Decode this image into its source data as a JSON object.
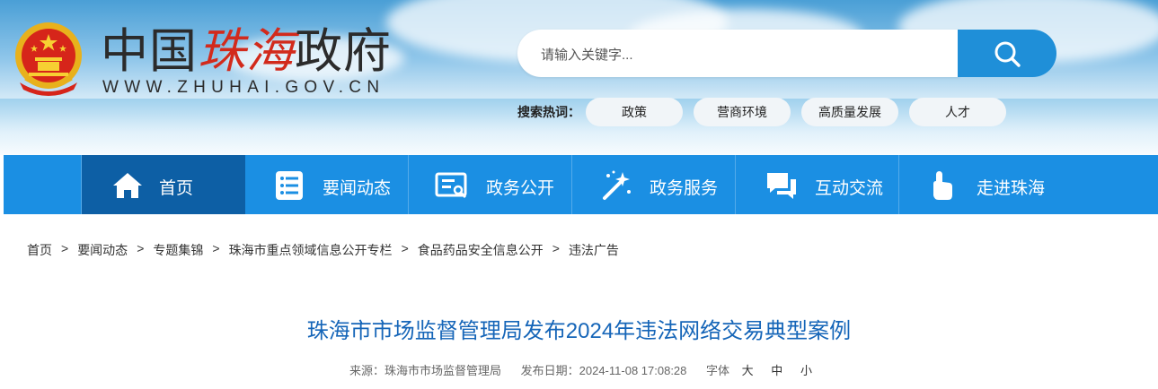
{
  "header": {
    "logo_main_a": "中国",
    "logo_main_b": "珠海",
    "logo_main_c": "政府",
    "logo_url": "WWW.ZHUHAI.GOV.CN",
    "search_placeholder": "请输入关键字...",
    "hot_label": "搜索热词：",
    "hot_tags": [
      "政策",
      "营商环境",
      "高质量发展",
      "人才"
    ]
  },
  "nav": {
    "items": [
      {
        "label": "首页",
        "icon": "home-icon",
        "active": true
      },
      {
        "label": "要闻动态",
        "icon": "news-list-icon"
      },
      {
        "label": "政务公开",
        "icon": "document-icon"
      },
      {
        "label": "政务服务",
        "icon": "magic-wand-icon"
      },
      {
        "label": "互动交流",
        "icon": "chat-icon"
      },
      {
        "label": "走进珠海",
        "icon": "pointer-hand-icon"
      }
    ]
  },
  "breadcrumb": [
    "首页",
    "要闻动态",
    "专题集锦",
    "珠海市重点领域信息公开专栏",
    "食品药品安全信息公开",
    "违法广告"
  ],
  "article": {
    "title": "珠海市市场监督管理局发布2024年违法网络交易典型案例",
    "source_label": "来源：珠海市市场监督管理局",
    "date_label": "发布日期：2024-11-08 17:08:28",
    "font_label": "字体",
    "font_sizes": [
      "大",
      "中",
      "小"
    ]
  },
  "colors": {
    "nav_bg": "#1b8fe3",
    "nav_active": "#0d5fa5",
    "search_button": "#1f8fd8",
    "title": "#1565b8",
    "logo_red": "#d22a1c"
  }
}
